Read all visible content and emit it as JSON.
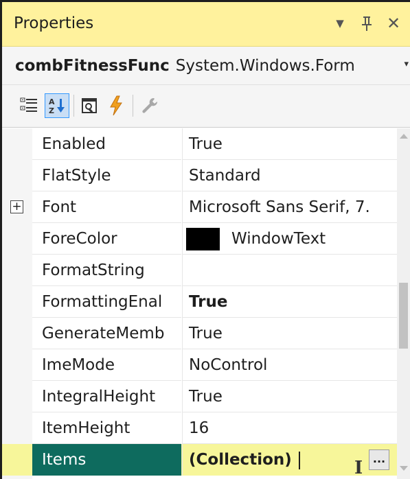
{
  "window": {
    "title": "Properties",
    "icons": {
      "dropdown": "chevron-down-icon",
      "pin": "pin-icon",
      "close": "close-icon"
    }
  },
  "object_selector": {
    "name": "combFitnessFunc",
    "type": "System.Windows.Form"
  },
  "toolbar": {
    "buttons": [
      {
        "name": "categorized-icon",
        "active": false
      },
      {
        "name": "alphabetical-icon",
        "active": true
      },
      {
        "name": "properties-icon",
        "active": false
      },
      {
        "name": "events-icon",
        "active": false
      },
      {
        "name": "property-pages-icon",
        "active": false
      }
    ]
  },
  "properties": [
    {
      "name": "Enabled",
      "value": "True"
    },
    {
      "name": "FlatStyle",
      "value": "Standard"
    },
    {
      "name": "Font",
      "value": "Microsoft Sans Serif, 7.",
      "expandable": true,
      "expander_symbol": "+"
    },
    {
      "name": "ForeColor",
      "value": "WindowText",
      "swatch_color": "#000000"
    },
    {
      "name": "FormatString",
      "value": ""
    },
    {
      "name": "FormattingEnal",
      "value": "True",
      "bold": true
    },
    {
      "name": "GenerateMemb",
      "value": "True"
    },
    {
      "name": "ImeMode",
      "value": "NoControl"
    },
    {
      "name": "IntegralHeight",
      "value": "True"
    },
    {
      "name": "ItemHeight",
      "value": "16"
    },
    {
      "name": "Items",
      "value": "(Collection)",
      "bold": true,
      "selected": true,
      "button_label": "..."
    }
  ],
  "colors": {
    "title_bar": "#fff29d",
    "selected_name_bg": "#0e6b5e",
    "selected_row_bg": "#f7f69a"
  }
}
